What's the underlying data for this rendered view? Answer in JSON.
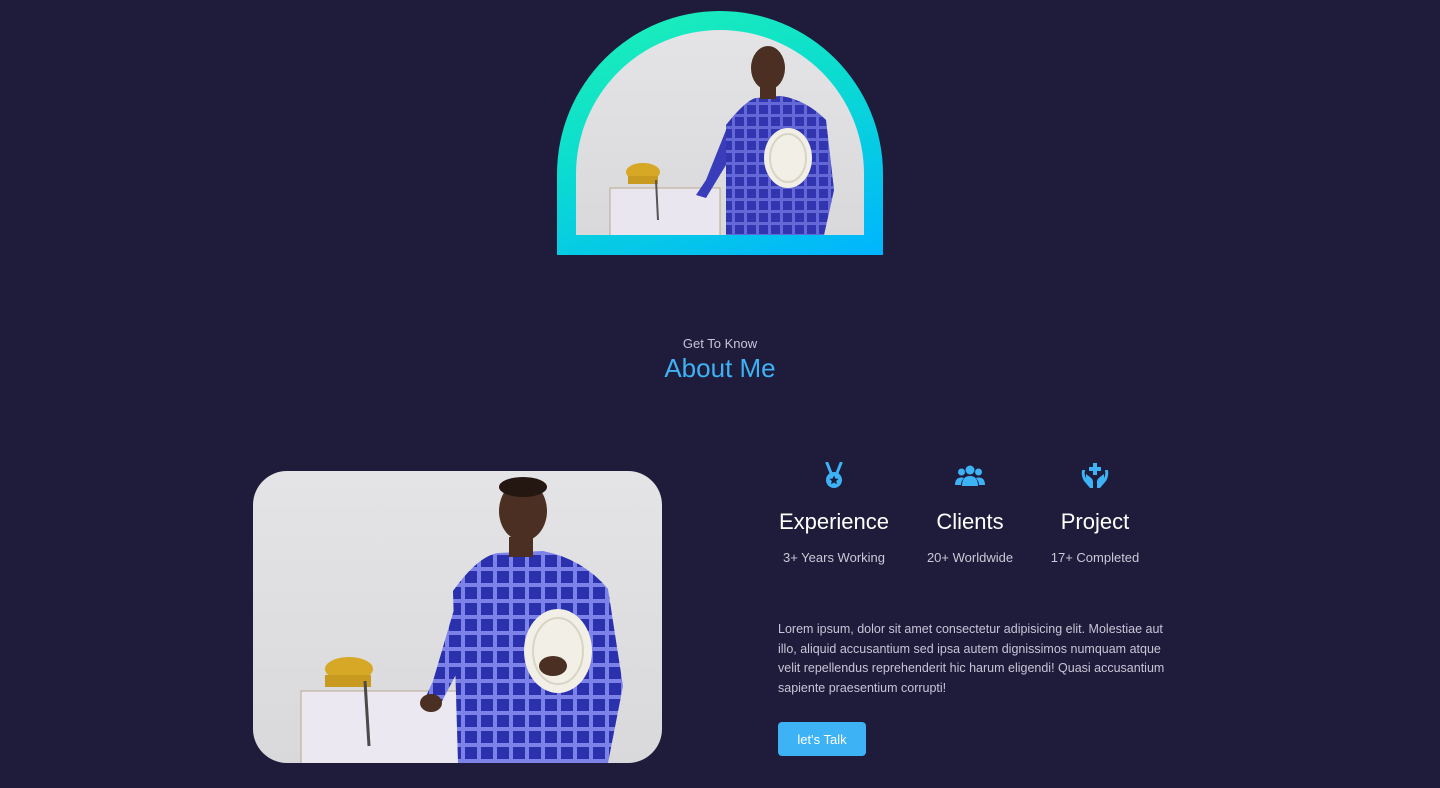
{
  "about": {
    "eyebrow": "Get To Know",
    "title": "About Me",
    "stats": [
      {
        "icon": "medal-icon",
        "title": "Experience",
        "subtitle": "3+ Years Working"
      },
      {
        "icon": "users-icon",
        "title": "Clients",
        "subtitle": "20+ Worldwide"
      },
      {
        "icon": "hands-heart-icon",
        "title": "Project",
        "subtitle": "17+ Completed"
      }
    ],
    "bio": "Lorem ipsum, dolor sit amet consectetur adipisicing elit. Molestiae aut illo, aliquid accusantium sed ipsa autem dignissimos numquam atque velit repellendus reprehenderit hic harum eligendi! Quasi accusantium sapiente praesentium corrupti!",
    "cta_label": "let's Talk"
  },
  "colors": {
    "background": "#1f1b3a",
    "accent": "#3db2f5",
    "arch_gradient_start": "#1ef2b4",
    "arch_gradient_end": "#00b4ff"
  }
}
